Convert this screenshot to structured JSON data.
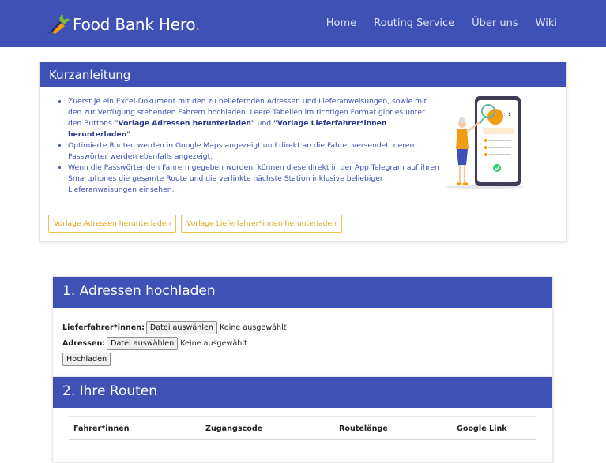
{
  "navbar": {
    "brand": "Food Bank Hero",
    "brand_dot": ".",
    "links": [
      "Home",
      "Routing Service",
      "Über uns",
      "Wiki"
    ],
    "brand_color": "#3f51b5",
    "logo_icon": "carrot-icon"
  },
  "guide": {
    "title": "Kurzanleitung",
    "items": [
      {
        "text_before": "Zuerst je ein Excel-Dokument mit den zu beliefernden Adressen und Lieferanweisungen, sowie mit den zur Verfügung stehenden Fahrern hochladen. Leere Tabellen im richtigen Format gibt es unter den Buttons ",
        "bold1": "\"Vorlage Adressen herunterladen\"",
        "mid": " und ",
        "bold2": "\"Vorlage Lieferfahrer*innen herunterladen\"",
        "text_after": "."
      },
      {
        "text": "Optimierte Routen werden in Google Maps angezeigt und direkt an die Fahrer versendet, deren Passwörter werden ebenfalls angezeigt."
      },
      {
        "text": "Wenn die Passwörter den Fahrern gegeben wurden, können diese direkt in der App Telegram auf ihren Smartphones die gesamte Route und die verlinkte nächste Station inklusive beliebiger Lieferanweisungen einsehen."
      }
    ],
    "button_addresses": "Vorlage Adressen herunterladen",
    "button_drivers": "Vorlage Lieferfahrer*innen herunterladen",
    "illustration_icon": "phone-search-illustration"
  },
  "upload": {
    "title": "1. Adressen hochladen",
    "drivers_label": "Lieferfahrer*innen:",
    "addresses_label": "Adressen:",
    "file_button": "Datei auswählen",
    "no_file": "Keine ausgewählt",
    "submit": "Hochladen"
  },
  "routes": {
    "title": "2. Ihre Routen",
    "columns": [
      "Fahrer*innen",
      "Zugangscode",
      "Routelänge",
      "Google Link"
    ]
  },
  "colors": {
    "primary": "#3f51b5",
    "accent": "#f5b041"
  }
}
